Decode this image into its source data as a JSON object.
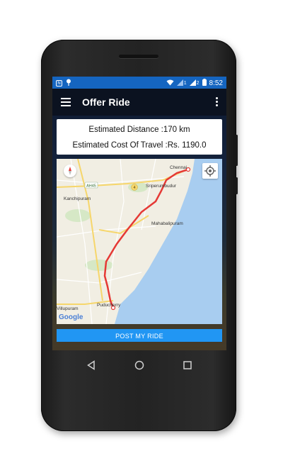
{
  "status_bar": {
    "left_icons": [
      "notification-n-icon",
      "pin-icon"
    ],
    "right_icons": [
      "wifi-icon",
      "signal-1-icon",
      "signal-2-icon",
      "battery-icon"
    ],
    "sim1": "1",
    "sim2": "2",
    "time": "8:52"
  },
  "app_bar": {
    "menu_icon": "hamburger-icon",
    "title": "Offer Ride",
    "overflow_icon": "more-vert-icon",
    "background": "#0b1220"
  },
  "ride_info": {
    "distance_text": "Estimated Distance :170 km",
    "cost_text": "Estimated Cost Of Travel :Rs. 1190.0"
  },
  "map": {
    "places": {
      "chennai": "Chennai",
      "sriperumbudur": "Sriperumbudur",
      "kanchipuram": "Kanchipuram",
      "mahabalipuram": "Mahabalipuram",
      "puducherry": "Puducherry",
      "villupuram": "Villupuram"
    },
    "highway": "AH45",
    "road_number": "4",
    "attribution": "Google",
    "compass_icon": "compass-icon",
    "location_icon": "my-location-icon",
    "route_color": "#e53935",
    "water_color": "#a8cdf0"
  },
  "post_button": {
    "label": "POST MY RIDE",
    "color": "#2196f3"
  },
  "nav_bar": {
    "back_icon": "back-triangle-icon",
    "home_icon": "home-circle-icon",
    "recents_icon": "recents-square-icon"
  }
}
